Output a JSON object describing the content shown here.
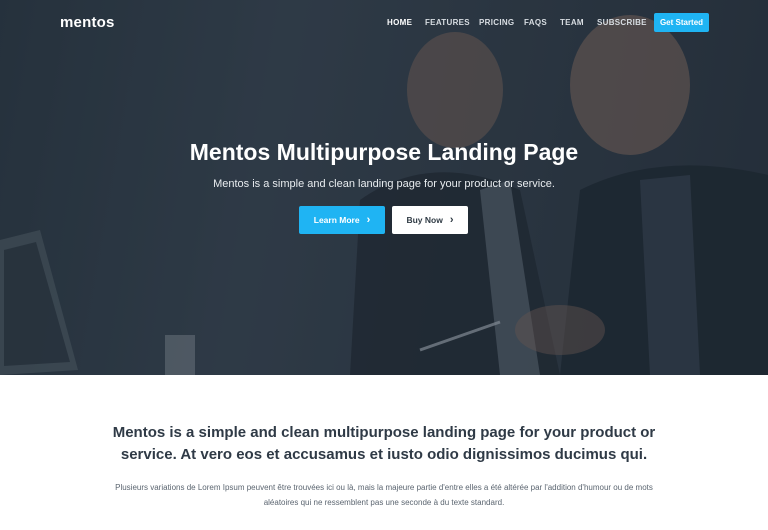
{
  "brand": {
    "logo": "mentos"
  },
  "nav": {
    "items": [
      {
        "label": "HOME"
      },
      {
        "label": "FEATURES"
      },
      {
        "label": "PRICING"
      },
      {
        "label": "FAQS"
      },
      {
        "label": "TEAM"
      },
      {
        "label": "SUBSCRIBE"
      }
    ],
    "cta": "Get Started"
  },
  "hero": {
    "title": "Mentos Multipurpose Landing Page",
    "subtitle": "Mentos is a simple and clean landing page for your product or service.",
    "primary_button": "Learn More",
    "secondary_button": "Buy Now",
    "chevron": "›"
  },
  "intro": {
    "heading": "Mentos is a simple and clean multipurpose landing page for your product or service. At vero eos et accusamus et iusto odio dignissimos ducimus qui.",
    "body": "Plusieurs variations de Lorem Ipsum peuvent être trouvées ici ou là, mais la majeure partie d'entre elles a été altérée par l'addition d'humour ou de mots aléatoires qui ne ressemblent pas une seconde à du texte standard."
  },
  "colors": {
    "accent": "#1fb4f3",
    "hero_bg": "#34404c",
    "heading": "#2f3a46"
  }
}
